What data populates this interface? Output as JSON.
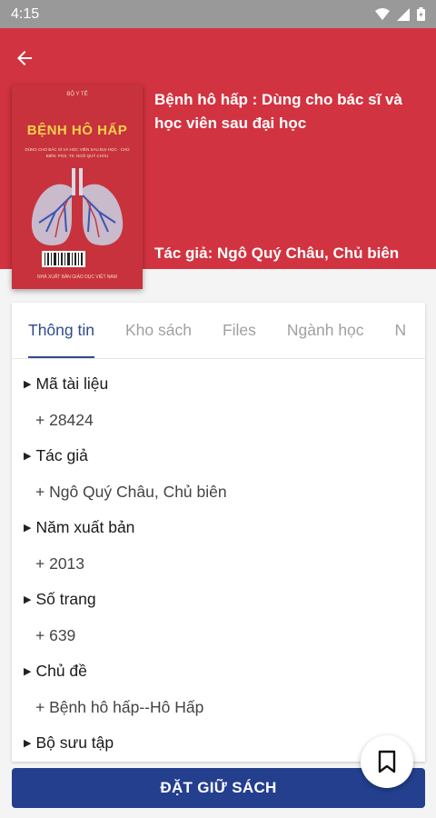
{
  "status_bar": {
    "time": "4:15"
  },
  "book": {
    "title": "Bệnh hô hấp : Dùng cho bác sĩ và học viên sau đại học",
    "author_line": "Tác giả: Ngô Quý Châu, Chủ biên",
    "cover": {
      "publisher": "BỘ Y TẾ",
      "title": "BỆNH HÔ HẤP",
      "subtitle": "DÙNG CHO BÁC SĨ VÀ HỌC VIÊN SAU ĐẠI HỌC · CHỦ BIÊN: PGS. TS. NGÔ QUÝ CHÂU",
      "footer": "NHÀ XUẤT BẢN GIÁO DỤC VIỆT NAM"
    }
  },
  "tabs": [
    {
      "label": "Thông tin",
      "active": true
    },
    {
      "label": "Kho sách",
      "active": false
    },
    {
      "label": "Files",
      "active": false
    },
    {
      "label": "Ngành học",
      "active": false
    },
    {
      "label": "N",
      "active": false
    }
  ],
  "fields": [
    {
      "label": "Mã tài liệu",
      "value": "+ 28424"
    },
    {
      "label": "Tác giả",
      "value": "+ Ngô Quý Châu, Chủ biên"
    },
    {
      "label": "Năm xuất bản",
      "value": "+ 2013"
    },
    {
      "label": "Số trang",
      "value": "+ 639"
    },
    {
      "label": "Chủ đề",
      "value": "+ Bệnh hô hấp--Hô Hấp"
    },
    {
      "label": "Bộ sưu tập",
      "value": ""
    }
  ],
  "actions": {
    "reserve_label": "ĐẶT GIỮ SÁCH"
  },
  "colors": {
    "header": "#d23340",
    "primary": "#233f8e",
    "tab_active": "#2f4a8f"
  },
  "icons": {
    "back": "arrow-left-icon",
    "bookmark": "bookmark-icon",
    "wifi": "wifi-icon",
    "signal": "signal-icon",
    "battery": "battery-icon"
  }
}
